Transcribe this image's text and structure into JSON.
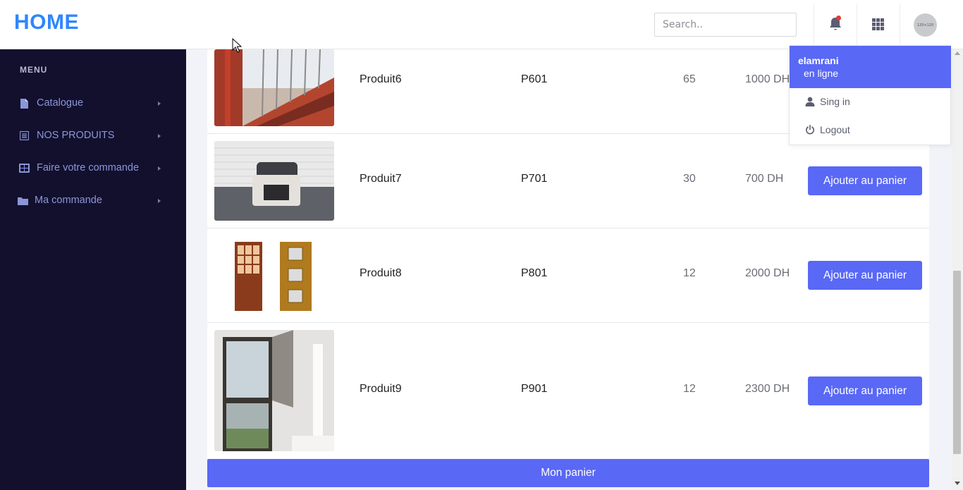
{
  "header": {
    "brand": "HOME",
    "search_placeholder": "Search..",
    "notification_icon": "bell-icon",
    "apps_icon": "grid-icon",
    "avatar_text": "120×120"
  },
  "sidebar": {
    "title": "MENU",
    "items": [
      {
        "label": "Catalogue",
        "icon": "file-icon"
      },
      {
        "label": "NOS PRODUITS",
        "icon": "list-icon"
      },
      {
        "label": "Faire votre commande",
        "icon": "table-icon"
      },
      {
        "label": "Ma commande",
        "icon": "folder-icon"
      }
    ]
  },
  "products": [
    {
      "name": "Produit6",
      "code": "P601",
      "qty": "65",
      "price": "1000 DH",
      "image": "staircase-photo"
    },
    {
      "name": "Produit7",
      "code": "P701",
      "qty": "30",
      "price": "700 DH",
      "button": "Ajouter au panier",
      "image": "armchair-photo"
    },
    {
      "name": "Produit8",
      "code": "P801",
      "qty": "12",
      "price": "2000 DH",
      "button": "Ajouter au panier",
      "image": "doors-photo"
    },
    {
      "name": "Produit9",
      "code": "P901",
      "qty": "12",
      "price": "2300 DH",
      "button": "Ajouter au panier",
      "image": "window-photo"
    }
  ],
  "cart_button": "Mon panier",
  "user_menu": {
    "username": "elamrani",
    "status": "en ligne",
    "items": [
      {
        "label": "Sing in",
        "icon": "user-icon"
      },
      {
        "label": "Logout",
        "icon": "power-icon"
      }
    ]
  },
  "colors": {
    "accent": "#5968f5",
    "brand": "#2f86ff",
    "sidebar_bg": "#13102e",
    "sidebar_text": "#8b96d8",
    "notification_dot": "#e53935"
  }
}
